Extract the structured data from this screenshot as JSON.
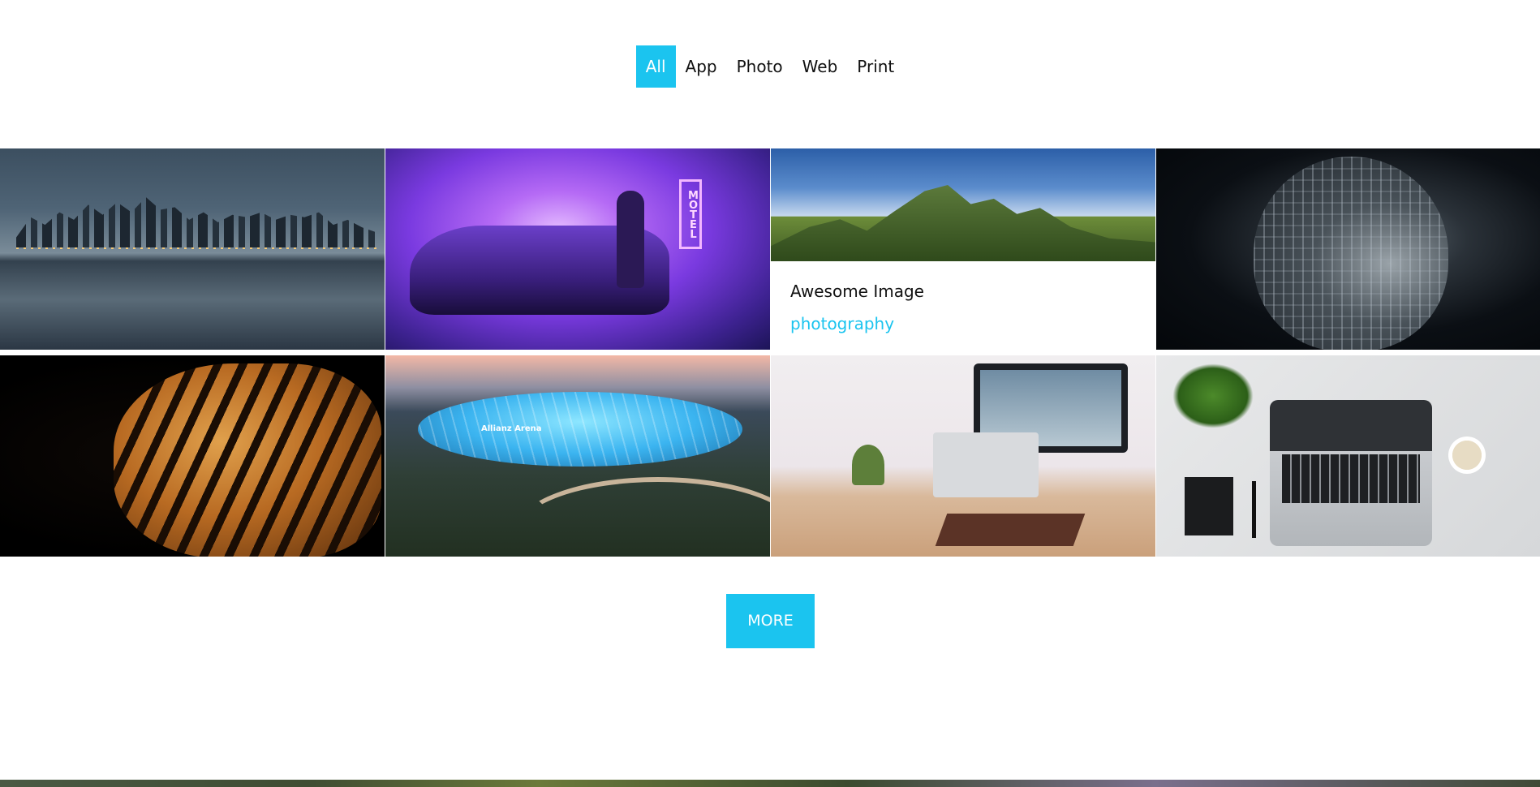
{
  "filters": [
    {
      "label": "All",
      "active": true
    },
    {
      "label": "App",
      "active": false
    },
    {
      "label": "Photo",
      "active": false
    },
    {
      "label": "Web",
      "active": false
    },
    {
      "label": "Print",
      "active": false
    }
  ],
  "portfolio": {
    "caption_title": "Awesome Image",
    "caption_category": "photography",
    "stadium_text": "Allianz Arena",
    "motel_text": "MOTEL"
  },
  "more_button": "MORE",
  "colors": {
    "accent": "#1bc4ef",
    "text": "#111111",
    "background": "#ffffff"
  }
}
